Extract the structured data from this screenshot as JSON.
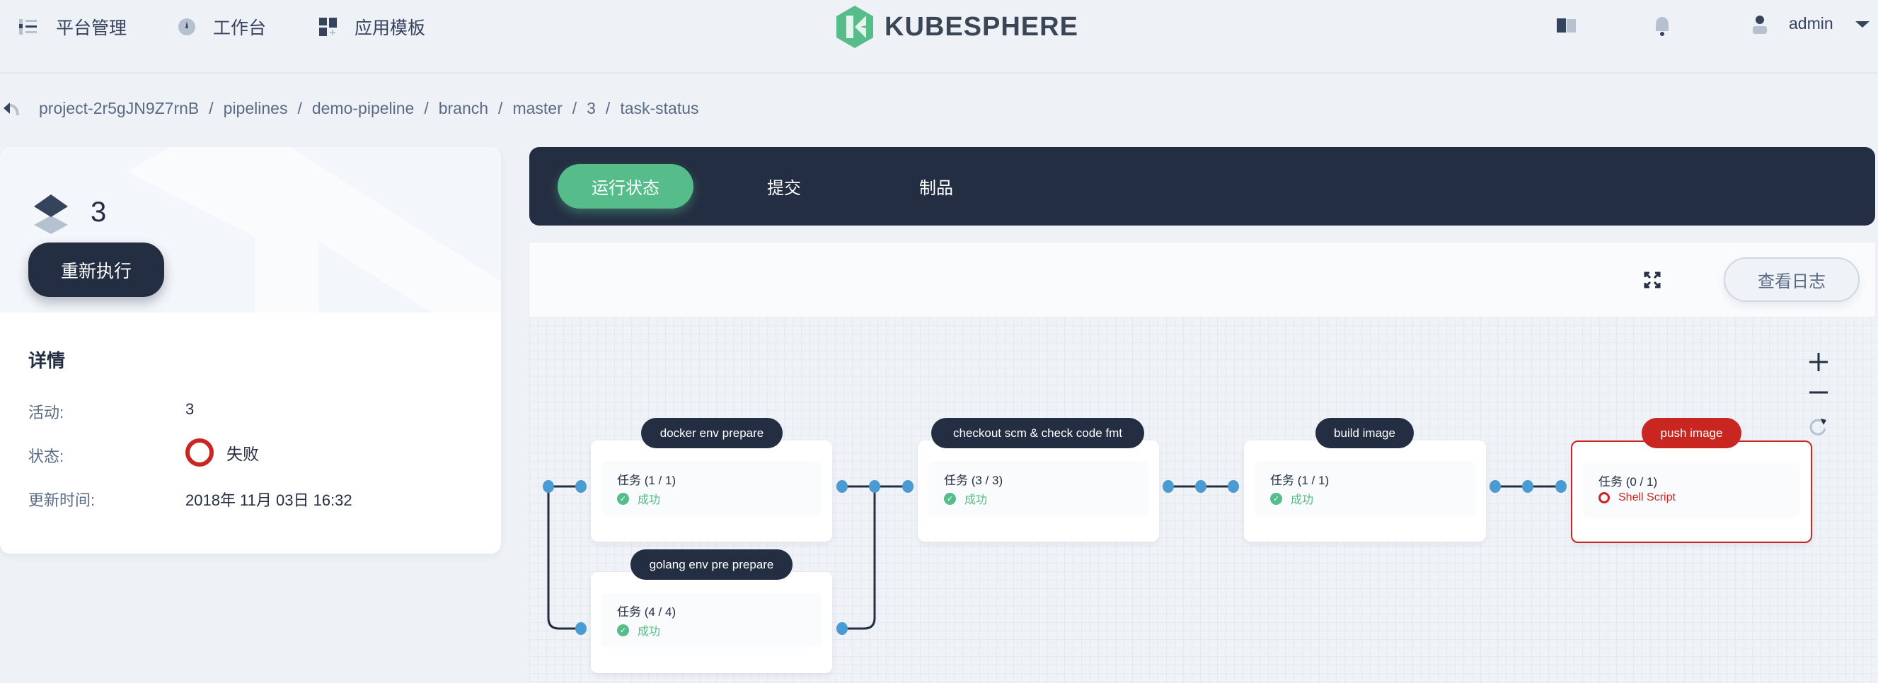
{
  "nav": {
    "items": [
      {
        "label": "平台管理",
        "icon": "list-icon"
      },
      {
        "label": "工作台",
        "icon": "dashboard-icon"
      },
      {
        "label": "应用模板",
        "icon": "app-template-icon"
      }
    ],
    "logo": "KUBESPHERE",
    "user": "admin"
  },
  "breadcrumb": [
    "project-2r5gJN9Z7rnB",
    "pipelines",
    "demo-pipeline",
    "branch",
    "master",
    "3",
    "task-status"
  ],
  "run": {
    "number": "3",
    "rerun_label": "重新执行",
    "details_title": "详情",
    "rows": [
      {
        "label": "活动:",
        "value": "3"
      },
      {
        "label": "状态:",
        "value": "失败"
      },
      {
        "label": "更新时间:",
        "value": "2018年 11月 03日 16:32"
      }
    ]
  },
  "tabs": [
    {
      "label": "运行状态",
      "active": true
    },
    {
      "label": "提交",
      "active": false
    },
    {
      "label": "制品",
      "active": false
    }
  ],
  "toolbar": {
    "view_log": "查看日志"
  },
  "colors": {
    "dark": "#242e42",
    "success": "#55bc8a",
    "fail": "#ca2621",
    "connector_dot": "#4a9bd1"
  },
  "stages": [
    {
      "name": "docker env prepare",
      "tasks": "任务 (1 / 1)",
      "status": "成功",
      "result": "success"
    },
    {
      "name": "golang env pre prepare",
      "tasks": "任务 (4 / 4)",
      "status": "成功",
      "result": "success"
    },
    {
      "name": "checkout scm & check code fmt",
      "tasks": "任务 (3 / 3)",
      "status": "成功",
      "result": "success"
    },
    {
      "name": "build image",
      "tasks": "任务 (1 / 1)",
      "status": "成功",
      "result": "success"
    },
    {
      "name": "push image",
      "tasks": "任务 (0 / 1)",
      "status": "Shell Script",
      "result": "failed"
    }
  ]
}
